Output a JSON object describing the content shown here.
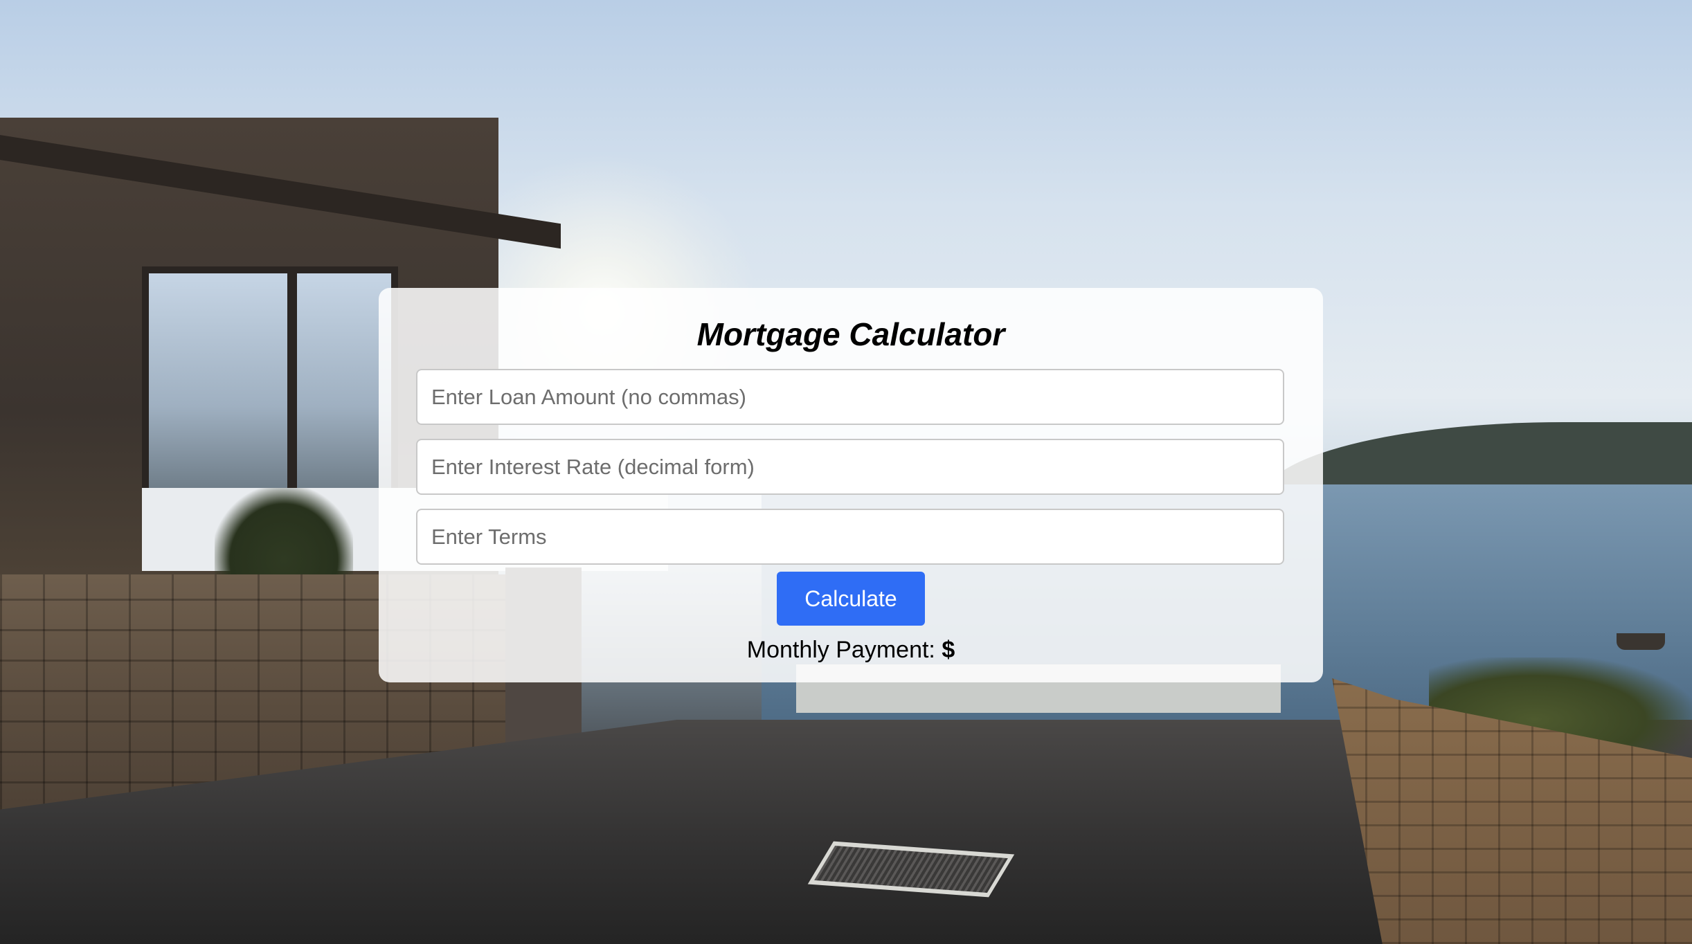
{
  "calculator": {
    "title": "Mortgage Calculator",
    "loan_amount": {
      "value": "",
      "placeholder": "Enter Loan Amount (no commas)"
    },
    "interest_rate": {
      "value": "",
      "placeholder": "Enter Interest Rate (decimal form)"
    },
    "terms": {
      "value": "",
      "placeholder": "Enter Terms"
    },
    "calculate_label": "Calculate",
    "result_label": "Monthly Payment:",
    "result_value": "$"
  },
  "colors": {
    "button": "#2f6df5",
    "card": "#ffffff"
  }
}
